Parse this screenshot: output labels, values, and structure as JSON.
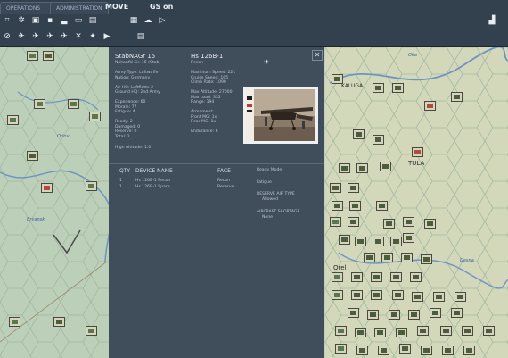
{
  "tabs": [
    "OPERATIONS",
    "ADMINISTRATION"
  ],
  "mode_label": "MOVE",
  "gs_label": "GS on",
  "map_labels": [
    "KALUGA",
    "TULA",
    "Orel",
    "Oka",
    "Orlov",
    "Bryansk",
    "Desna"
  ],
  "unit": {
    "name": "StabNAGr 15",
    "subtitle": "Nahaufkl.Gr. 15 (Stab)",
    "lines_left": [
      "Army Type: Luftwaffe",
      "Nation: Germany",
      "",
      "Air HQ: Luftflotte 2",
      "Ground HQ: 2nd Army",
      "",
      "Experience: 60",
      "Morale: 77",
      "Fatigue: 4",
      "",
      "Ready: 2",
      "Damaged: 0",
      "Reserve: 0",
      "Total: 2"
    ],
    "footer_left": "High Altitude: 1.0"
  },
  "aircraft": {
    "type": "Hs 126B-1",
    "role": "Recon",
    "lines": [
      "Maximum Speed: 221",
      "Cruise Speed: 165",
      "Climb Rate: 1090",
      "",
      "Max Altitude: 27000",
      "Max Load: 332",
      "Range: 194",
      "",
      "Armament:",
      "Front MG: 1x",
      "Rear MG: 1x",
      "",
      "Endurance: 6"
    ]
  },
  "table": {
    "headers": [
      "QTY",
      "DEVICE NAME",
      "FACE"
    ],
    "rows": [
      {
        "qty": "1",
        "name": "Hs 126B-1 Recon",
        "face": "Recon"
      },
      {
        "qty": "1",
        "name": "Hs 126B-1 Spare",
        "face": "Reserve"
      }
    ]
  },
  "right_notes": [
    "Ready Mode",
    "Fatigue",
    "RESERVE AIR TYPE",
    "Allowed",
    "AIRCRAFT SHORTAGE",
    "None"
  ],
  "colors": {
    "panel_bg": "#404d5b",
    "map_bg": "#b9ccb6",
    "accent": "#b44a3e"
  }
}
